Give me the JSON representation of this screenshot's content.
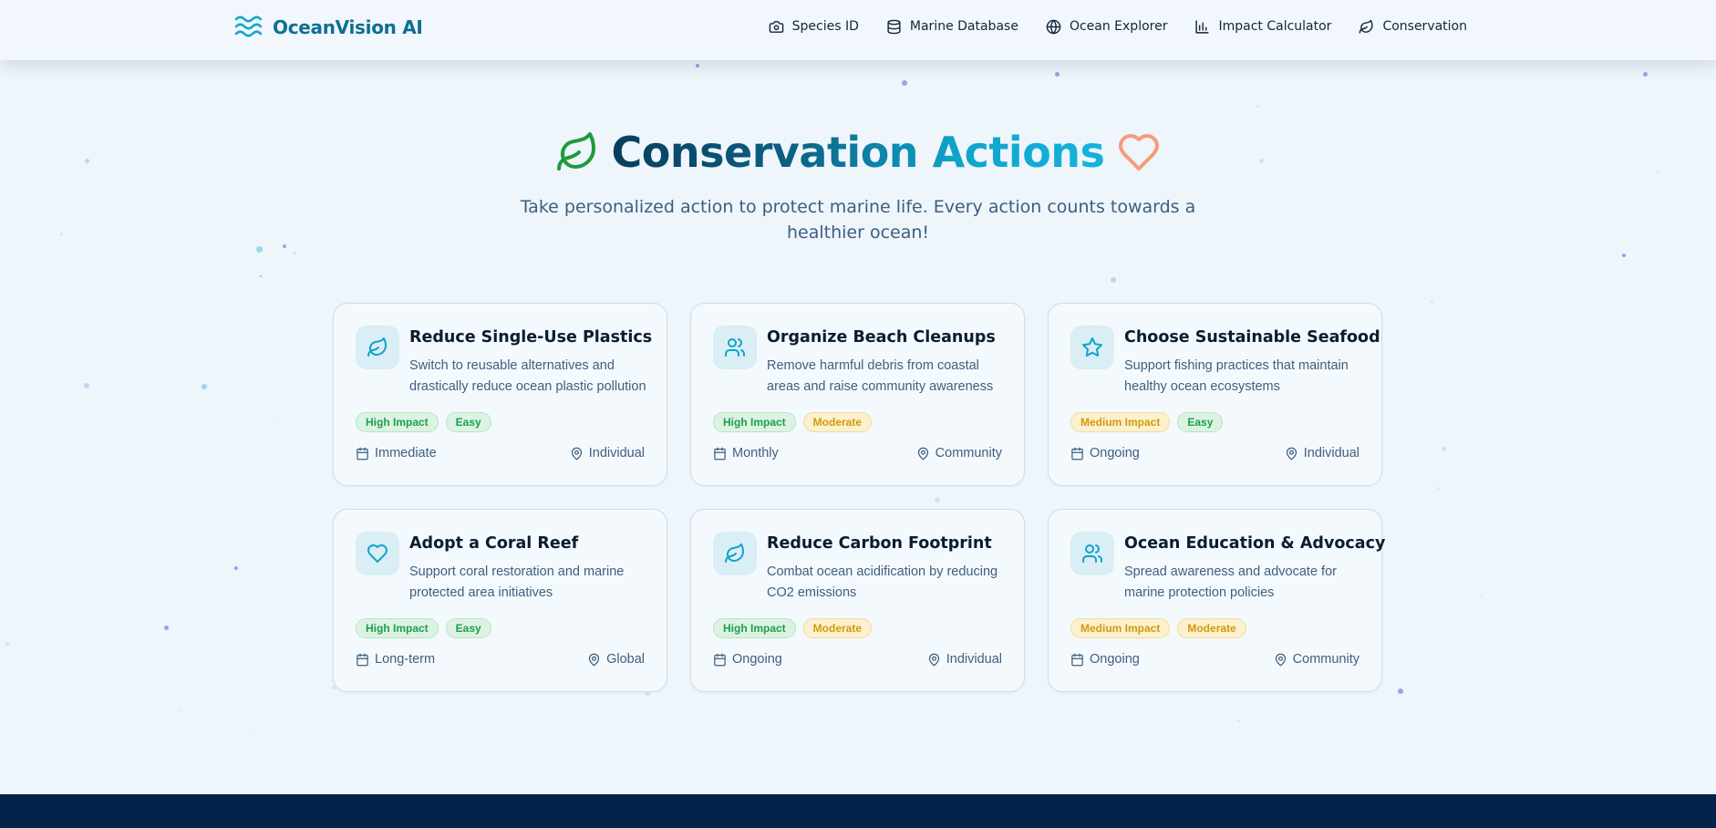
{
  "header": {
    "brand": "OceanVision AI",
    "nav": [
      {
        "label": "Species ID",
        "icon": "camera-icon"
      },
      {
        "label": "Marine Database",
        "icon": "database-icon"
      },
      {
        "label": "Ocean Explorer",
        "icon": "globe-icon"
      },
      {
        "label": "Impact Calculator",
        "icon": "bar-chart-icon"
      },
      {
        "label": "Conservation",
        "icon": "leaf-icon"
      }
    ]
  },
  "hero": {
    "title": "Conservation Actions",
    "subtitle": "Take personalized action to protect marine life. Every action counts towards a healthier ocean!"
  },
  "colors": {
    "accent": "#10a3c9",
    "brand": "#0e6f93",
    "leaf_green": "#1f9a3a",
    "heart_orange": "#f79b7a",
    "footer": "#03234b"
  },
  "actions": [
    {
      "title": "Reduce Single-Use Plastics",
      "description": "Switch to reusable alternatives and drastically reduce ocean plastic pollution",
      "icon": "leaf-icon",
      "tags": [
        {
          "label": "High Impact",
          "tone": "green"
        },
        {
          "label": "Easy",
          "tone": "green"
        }
      ],
      "timeframe": "Immediate",
      "scope": "Individual"
    },
    {
      "title": "Organize Beach Cleanups",
      "description": "Remove harmful debris from coastal areas and raise community awareness",
      "icon": "users-icon",
      "tags": [
        {
          "label": "High Impact",
          "tone": "green"
        },
        {
          "label": "Moderate",
          "tone": "yellow"
        }
      ],
      "timeframe": "Monthly",
      "scope": "Community"
    },
    {
      "title": "Choose Sustainable Seafood",
      "description": "Support fishing practices that maintain healthy ocean ecosystems",
      "icon": "star-icon",
      "tags": [
        {
          "label": "Medium Impact",
          "tone": "yellow"
        },
        {
          "label": "Easy",
          "tone": "green"
        }
      ],
      "timeframe": "Ongoing",
      "scope": "Individual"
    },
    {
      "title": "Adopt a Coral Reef",
      "description": "Support coral restoration and marine protected area initiatives",
      "icon": "heart-icon",
      "tags": [
        {
          "label": "High Impact",
          "tone": "green"
        },
        {
          "label": "Easy",
          "tone": "green"
        }
      ],
      "timeframe": "Long-term",
      "scope": "Global"
    },
    {
      "title": "Reduce Carbon Footprint",
      "description": "Combat ocean acidification by reducing CO2 emissions",
      "icon": "leaf-icon",
      "tags": [
        {
          "label": "High Impact",
          "tone": "green"
        },
        {
          "label": "Moderate",
          "tone": "yellow"
        }
      ],
      "timeframe": "Ongoing",
      "scope": "Individual"
    },
    {
      "title": "Ocean Education & Advocacy",
      "description": "Spread awareness and advocate for marine protection policies",
      "icon": "users-icon",
      "tags": [
        {
          "label": "Medium Impact",
          "tone": "yellow"
        },
        {
          "label": "Moderate",
          "tone": "yellow"
        }
      ],
      "timeframe": "Ongoing",
      "scope": "Community"
    }
  ]
}
